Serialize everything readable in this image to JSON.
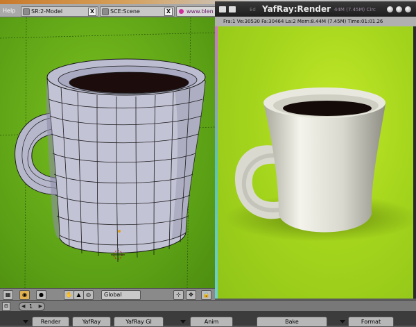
{
  "header": {
    "help_label": "Help",
    "tabs": [
      {
        "label": "SR:2-Model",
        "close": "X"
      },
      {
        "label": "SCE:Scene",
        "close": "X"
      },
      {
        "label": "www.blen"
      }
    ]
  },
  "render_window": {
    "title": "YafRay:Render",
    "ghost_text": "Ed",
    "ghost_right": "44M (7.45M) Circ",
    "stats": "Fra:1   Ve:30530  Fa:30464  La:2  Mem:8.44M (7.45M)  Time:01:01.26"
  },
  "viewport_toolbar": {
    "orientation_value": "Global"
  },
  "frame": {
    "value": "1",
    "left_arrow": "◀",
    "right_arrow": "▶"
  },
  "panel_tabs": [
    {
      "label": "Render"
    },
    {
      "label": "YafRay"
    },
    {
      "label": "YafRay GI"
    },
    {
      "label": "Anim"
    },
    {
      "label": "Bake"
    },
    {
      "label": "Format"
    }
  ],
  "colors": {
    "viewport_bg": "#5ea518",
    "render_bg": "#a6d61d",
    "mug_render": "#e9e9e1",
    "mug_wire": "#b8b8cc"
  },
  "icons": [
    "grip-icon",
    "close-icon",
    "browser-icon",
    "window-menu-icon",
    "minimize-icon",
    "maximize-icon",
    "window-close-icon",
    "hand-icon",
    "rotate-icon",
    "scale-icon",
    "lock-icon",
    "pivot-icon",
    "view-icon"
  ]
}
